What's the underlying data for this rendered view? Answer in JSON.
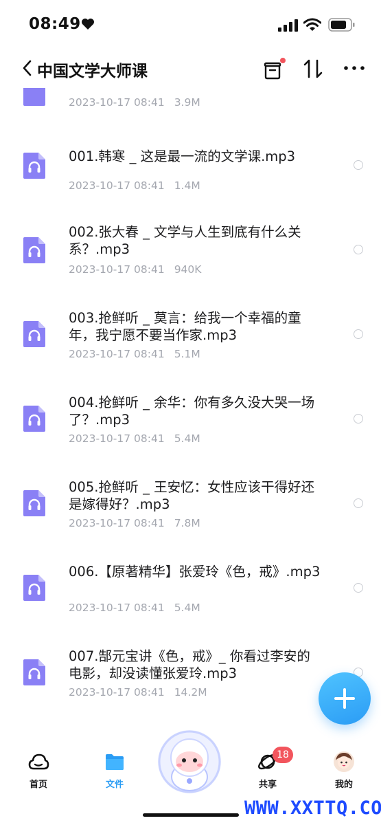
{
  "status_bar": {
    "time": "08:49"
  },
  "nav": {
    "title": "中国文学大师课"
  },
  "colors": {
    "accent": "#2a9cf4",
    "file_icon": "#8a80f5",
    "badge": "#f2555d",
    "meta_text": "#a5a8b0"
  },
  "files": [
    {
      "name": "",
      "date": "2023-10-17 08:41",
      "size": "3.9M"
    },
    {
      "name": "001.韩寒 _ 这是最一流的文学课.mp3",
      "date": "2023-10-17 08:41",
      "size": "1.4M"
    },
    {
      "name": "002.张大春 _ 文学与人生到底有什么关系？.mp3",
      "date": "2023-10-17 08:41",
      "size": "940K"
    },
    {
      "name": "003.抢鲜听 _ 莫言：给我一个幸福的童年，我宁愿不要当作家.mp3",
      "date": "2023-10-17 08:41",
      "size": "5.1M"
    },
    {
      "name": "004.抢鲜听 _ 余华：你有多久没大哭一场了？.mp3",
      "date": "2023-10-17 08:41",
      "size": "5.4M"
    },
    {
      "name": "005.抢鲜听 _ 王安忆：女性应该干得好还是嫁得好？.mp3",
      "date": "2023-10-17 08:41",
      "size": "7.8M"
    },
    {
      "name": "006.【原著精华】张爱玲《色，戒》.mp3",
      "date": "2023-10-17 08:41",
      "size": "5.4M"
    },
    {
      "name": "007.郜元宝讲《色，戒》_ 你看过李安的电影，却没读懂张爱玲.mp3",
      "date": "2023-10-17 08:41",
      "size": "14.2M"
    }
  ],
  "tabs": [
    {
      "label": "首页",
      "icon": "cloud-icon"
    },
    {
      "label": "文件",
      "icon": "folder-icon"
    },
    {
      "label": "共享",
      "icon": "share-orbit-icon",
      "badge": "18"
    },
    {
      "label": "我的",
      "icon": "avatar"
    }
  ],
  "watermark": "WWW.XXTTQ.COM"
}
